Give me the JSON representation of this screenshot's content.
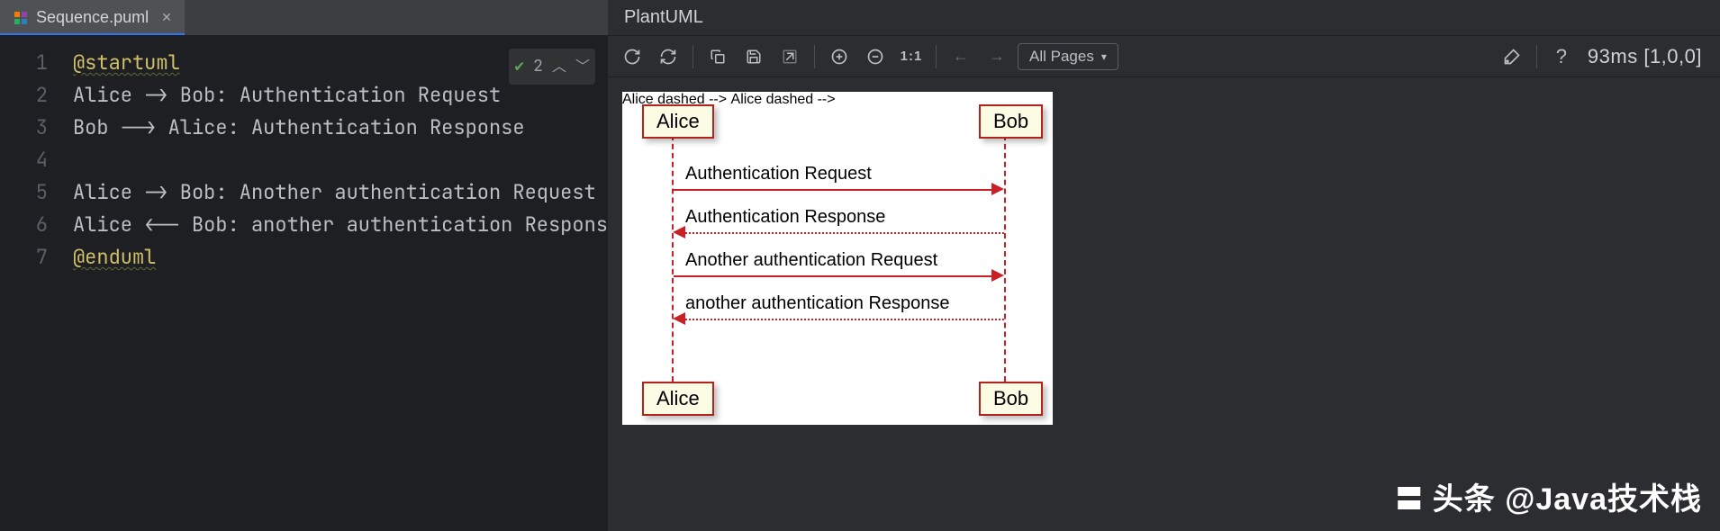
{
  "editor": {
    "tab": {
      "filename": "Sequence.puml"
    },
    "line_numbers": [
      "1",
      "2",
      "3",
      "4",
      "5",
      "6",
      "7"
    ],
    "code_lines": [
      {
        "type": "kw",
        "text": "@startuml"
      },
      {
        "type": "plain",
        "text": "Alice -> Bob: Authentication Request"
      },
      {
        "type": "plain",
        "text": "Bob --> Alice: Authentication Response"
      },
      {
        "type": "plain",
        "text": ""
      },
      {
        "type": "plain",
        "text": "Alice -> Bob: Another authentication Request"
      },
      {
        "type": "plain",
        "text": "Alice <-- Bob: another authentication Respons"
      },
      {
        "type": "kw",
        "text": "@enduml"
      }
    ],
    "inspection_count": "2"
  },
  "preview": {
    "title": "PlantUML",
    "pages_label": "All Pages",
    "timing": "93ms [1,0,0]"
  },
  "diagram": {
    "actors": {
      "a": "Alice",
      "b": "Bob"
    },
    "messages": [
      "Authentication Request",
      "Authentication Response",
      "Another authentication Request",
      "another authentication Response"
    ]
  },
  "watermark": "头条 @Java技术栈"
}
